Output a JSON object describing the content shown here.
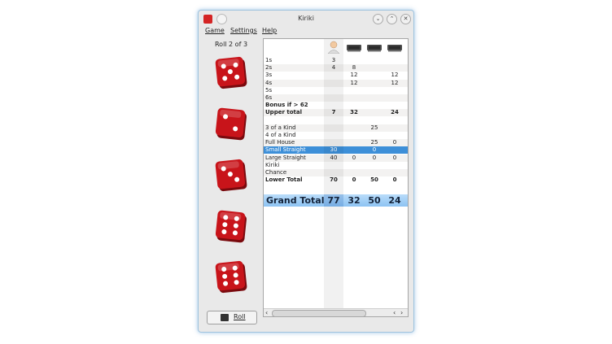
{
  "window": {
    "title": "Kiriki"
  },
  "menu": {
    "game": "Game",
    "settings": "Settings",
    "help": "Help"
  },
  "roll_status": "Roll 2 of 3",
  "dice": [
    {
      "value": 5,
      "icon": "die-five-icon"
    },
    {
      "value": 2,
      "icon": "die-two-icon"
    },
    {
      "value": 3,
      "icon": "die-three-icon"
    },
    {
      "value": 6,
      "icon": "die-six-icon"
    },
    {
      "value": 6,
      "icon": "die-six-icon"
    }
  ],
  "roll_button": {
    "label": "Roll",
    "icon": "dice-icon"
  },
  "players": [
    {
      "icon": "human-player-icon"
    },
    {
      "icon": "computer-player-icon"
    },
    {
      "icon": "computer-player-icon"
    },
    {
      "icon": "computer-player-icon"
    }
  ],
  "scores": [
    {
      "label": "1s",
      "values": [
        "3",
        "",
        "",
        ""
      ]
    },
    {
      "label": "2s",
      "values": [
        "4",
        "8",
        "",
        ""
      ]
    },
    {
      "label": "3s",
      "values": [
        "",
        "12",
        "",
        "12"
      ]
    },
    {
      "label": "4s",
      "values": [
        "",
        "12",
        "",
        "12"
      ]
    },
    {
      "label": "5s",
      "values": [
        "",
        "",
        "",
        ""
      ]
    },
    {
      "label": "6s",
      "values": [
        "",
        "",
        "",
        ""
      ]
    },
    {
      "label": "Bonus if > 62",
      "values": [
        "",
        "",
        "",
        ""
      ]
    },
    {
      "label": "Upper total",
      "values": [
        "7",
        "32",
        "",
        "24"
      ]
    },
    {
      "label": "",
      "values": [
        "",
        "",
        "",
        ""
      ]
    },
    {
      "label": "3 of a Kind",
      "values": [
        "",
        "",
        "25",
        ""
      ]
    },
    {
      "label": "4 of a Kind",
      "values": [
        "",
        "",
        "",
        ""
      ]
    },
    {
      "label": "Full House",
      "values": [
        "",
        "",
        "25",
        "0"
      ]
    },
    {
      "label": "Small Straight",
      "values": [
        "30",
        "",
        "0",
        ""
      ]
    },
    {
      "label": "Large Straight",
      "values": [
        "40",
        "0",
        "0",
        "0"
      ]
    },
    {
      "label": "Kiriki",
      "values": [
        "",
        "",
        "",
        ""
      ]
    },
    {
      "label": "Chance",
      "values": [
        "",
        "",
        "",
        ""
      ]
    },
    {
      "label": "Lower Total",
      "values": [
        "70",
        "0",
        "50",
        "0"
      ]
    }
  ],
  "grand_total": {
    "label": "Grand Total",
    "values": [
      "77",
      "32",
      "50",
      "24"
    ]
  },
  "colors": {
    "die_red": "#c8141a",
    "selection": "#3d8fd8",
    "grand_total_bg": "#a6cff6"
  }
}
